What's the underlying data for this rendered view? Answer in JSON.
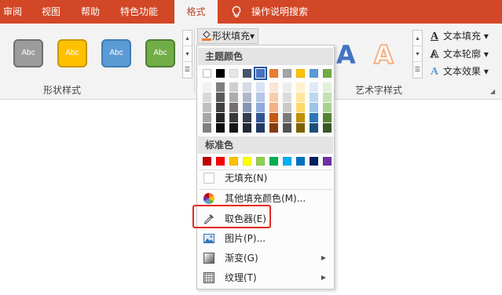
{
  "tabs": [
    {
      "label": "审阅",
      "active": false
    },
    {
      "label": "视图",
      "active": false
    },
    {
      "label": "帮助",
      "active": false
    },
    {
      "label": "特色功能",
      "active": false
    },
    {
      "label": "格式",
      "active": true
    }
  ],
  "tell_me": {
    "icon": "lightbulb-icon",
    "label": "操作说明搜索"
  },
  "shape_styles": {
    "group_label": "形状样式",
    "presets": [
      {
        "label": "Abc",
        "fill": "#9c9c9c",
        "border": "#6f6f6f"
      },
      {
        "label": "Abc",
        "fill": "#ffc000",
        "border": "#c99700"
      },
      {
        "label": "Abc",
        "fill": "#5b9bd5",
        "border": "#3e7cb5"
      },
      {
        "label": "Abc",
        "fill": "#70ad47",
        "border": "#507e32"
      }
    ]
  },
  "shape_fill_button": {
    "label": "形状填充",
    "arrow": "▾",
    "icon": "paint-bucket-icon"
  },
  "wordart": {
    "group_label": "艺术字样式",
    "samples": [
      {
        "label": "A",
        "color": "#4472c4"
      },
      {
        "label": "A",
        "color": "#f4b183"
      }
    ]
  },
  "text_commands": [
    {
      "label": "文本填充",
      "icon": "text-fill-icon",
      "arrow": "▾"
    },
    {
      "label": "文本轮廓",
      "icon": "text-outline-icon",
      "arrow": "▾"
    },
    {
      "label": "文本效果",
      "icon": "text-effects-icon",
      "arrow": "▾"
    }
  ],
  "fill_menu": {
    "theme_colors_title": "主题颜色",
    "theme_colors": [
      {
        "base": "#ffffff",
        "shades": [
          "#f2f2f2",
          "#d9d9d9",
          "#bfbfbf",
          "#a6a6a6",
          "#808080"
        ]
      },
      {
        "base": "#000000",
        "shades": [
          "#7f7f7f",
          "#595959",
          "#404040",
          "#262626",
          "#0d0d0d"
        ]
      },
      {
        "base": "#e7e6e6",
        "shades": [
          "#d0cece",
          "#aeabab",
          "#757171",
          "#3b3838",
          "#171616"
        ]
      },
      {
        "base": "#44546a",
        "shades": [
          "#d6dce5",
          "#adb9ca",
          "#8497b0",
          "#333f50",
          "#222a35"
        ]
      },
      {
        "base": "#4472c4",
        "shades": [
          "#dae3f3",
          "#b4c7e7",
          "#8faadc",
          "#2f5597",
          "#203864"
        ]
      },
      {
        "base": "#ed7d31",
        "shades": [
          "#fbe5d6",
          "#f8cbad",
          "#f4b183",
          "#c55a11",
          "#843c0c"
        ]
      },
      {
        "base": "#a5a5a5",
        "shades": [
          "#ededed",
          "#dbdbdb",
          "#c9c9c9",
          "#7b7b7b",
          "#525252"
        ]
      },
      {
        "base": "#ffc000",
        "shades": [
          "#fff2cc",
          "#ffe699",
          "#ffd966",
          "#bf9000",
          "#7f6000"
        ]
      },
      {
        "base": "#5b9bd5",
        "shades": [
          "#deebf7",
          "#bdd7ee",
          "#9dc3e6",
          "#2e75b6",
          "#1f4e79"
        ]
      },
      {
        "base": "#70ad47",
        "shades": [
          "#e2f0d9",
          "#c5e0b4",
          "#a9d18e",
          "#548235",
          "#385723"
        ]
      }
    ],
    "selected_theme_index": 4,
    "standard_colors_title": "标准色",
    "standard_colors": [
      "#c00000",
      "#ff0000",
      "#ffc000",
      "#ffff00",
      "#92d050",
      "#00b050",
      "#00b0f0",
      "#0070c0",
      "#002060",
      "#7030a0"
    ],
    "no_fill": {
      "label": "无填充(N)",
      "icon": "no-fill-icon"
    },
    "more_colors": {
      "label": "其他填充颜色(M)...",
      "icon": "color-wheel-icon"
    },
    "eyedropper": {
      "label": "取色器(E)",
      "icon": "eyedropper-icon",
      "highlight_color": "#e8281f"
    },
    "picture": {
      "label": "图片(P)...",
      "icon": "picture-icon"
    },
    "gradient": {
      "label": "渐变(G)",
      "icon": "gradient-icon",
      "submenu_arrow": "▶"
    },
    "texture": {
      "label": "纹理(T)",
      "icon": "texture-icon",
      "submenu_arrow": "▶"
    }
  },
  "colors": {
    "ribbon_accent": "#d24726",
    "ribbon_bg": "#f3f3f3",
    "highlight": "#e8281f"
  }
}
